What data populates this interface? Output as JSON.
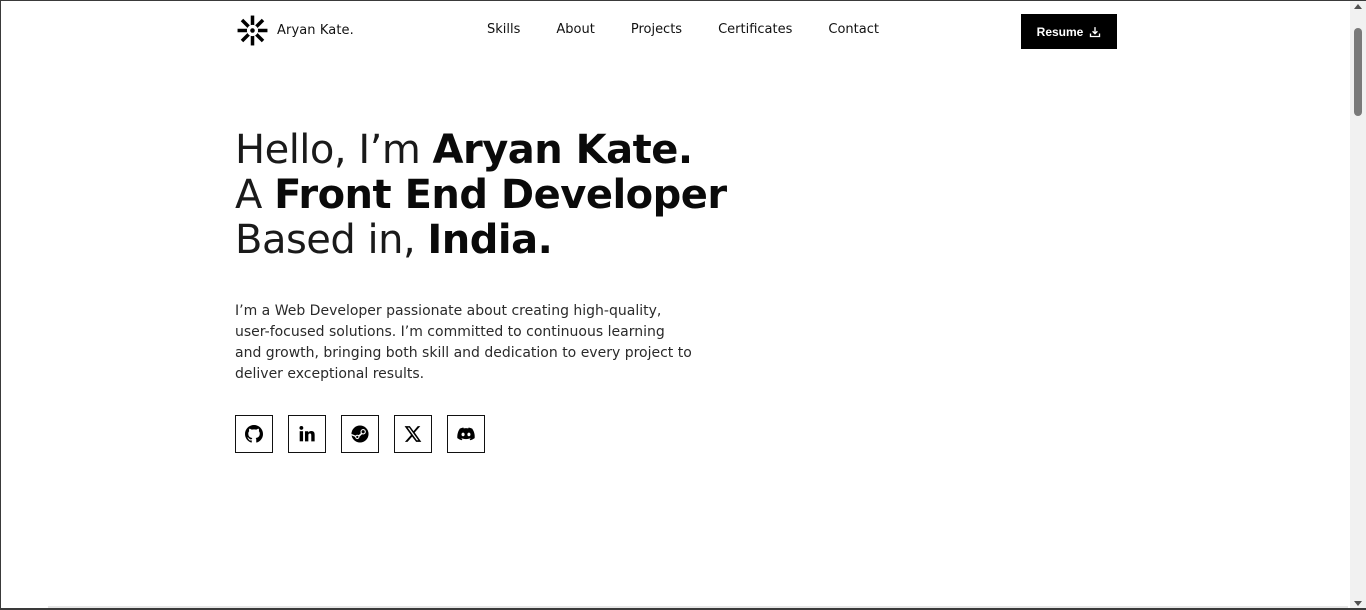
{
  "header": {
    "logo_text": "Aryan Kate.",
    "nav": [
      {
        "label": "Skills"
      },
      {
        "label": "About"
      },
      {
        "label": "Projects"
      },
      {
        "label": "Certificates"
      },
      {
        "label": "Contact"
      }
    ],
    "resume_label": "Resume"
  },
  "hero": {
    "line1_light": "Hello, I’m ",
    "line1_bold": "Aryan Kate.",
    "line2_light": "A ",
    "line2_bold": "Front End Developer",
    "line3_light": "Based in, ",
    "line3_bold": "India."
  },
  "intro": {
    "text": "I’m a Web Developer passionate about creating high-quality, user-focused solutions. I’m committed to continuous learning and growth, bringing both skill and dedication to every project to deliver exceptional results."
  },
  "socials": [
    {
      "icon": "github-icon"
    },
    {
      "icon": "linkedin-icon"
    },
    {
      "icon": "steam-icon"
    },
    {
      "icon": "x-twitter-icon"
    },
    {
      "icon": "discord-icon"
    }
  ],
  "colors": {
    "primary": "#000000",
    "background": "#ffffff",
    "text": "#111111"
  }
}
